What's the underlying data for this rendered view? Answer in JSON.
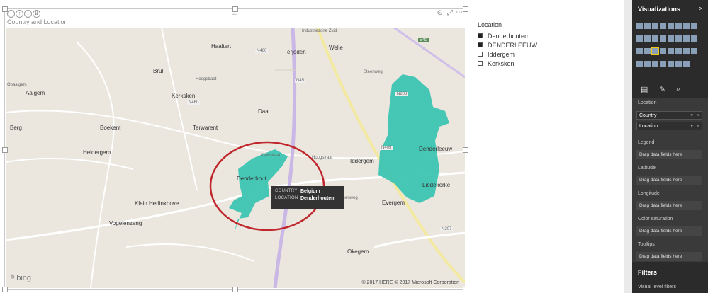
{
  "visual": {
    "title": "Country and Location",
    "tooltip": {
      "country_key": "COUNTRY",
      "country_val": "Belgium",
      "location_key": "LOCATION",
      "location_val": "Denderhoutem"
    },
    "bing": "bing",
    "copyright": "© 2017 HERE  © 2017 Microsoft Corporation"
  },
  "map_labels": [
    {
      "name": "Brul",
      "text": "Brul"
    },
    {
      "name": "Haaltert",
      "text": "Haaltert"
    },
    {
      "name": "Terjoden",
      "text": "Terjoden"
    },
    {
      "name": "Welle",
      "text": "Welle"
    },
    {
      "name": "Aaigem",
      "text": "Aaigem"
    },
    {
      "name": "Kerksken",
      "text": "Kerksken"
    },
    {
      "name": "Daal",
      "text": "Daal"
    },
    {
      "name": "Berg",
      "text": "Berg"
    },
    {
      "name": "Boekent",
      "text": "Boekent"
    },
    {
      "name": "Terwarent",
      "text": "Terwarent"
    },
    {
      "name": "Heldergem",
      "text": "Heldergem"
    },
    {
      "name": "Denderhoutem",
      "text": "Denderhout"
    },
    {
      "name": "Iddergem",
      "text": "Iddergem"
    },
    {
      "name": "Denderleeuw",
      "text": "Denderleeuw"
    },
    {
      "name": "Liedekerke",
      "text": "Liedekerke"
    },
    {
      "name": "Klein Herlinkhove",
      "text": "Klein Herlinkhove"
    },
    {
      "name": "Evergem",
      "text": "Evergem"
    },
    {
      "name": "Vogelenzang",
      "text": "Vogelenzang"
    },
    {
      "name": "Okegem",
      "text": "Okegem"
    }
  ],
  "map_road_labels": [
    {
      "name": "industriezone",
      "text": "Industriezone Zuid"
    },
    {
      "name": "n460-1",
      "text": "N460"
    },
    {
      "name": "n460-2",
      "text": "N460"
    },
    {
      "name": "n45",
      "text": "N45"
    },
    {
      "name": "n208",
      "text": "N208"
    },
    {
      "name": "n405",
      "text": "N405"
    },
    {
      "name": "n207",
      "text": "N207"
    },
    {
      "name": "e40",
      "text": "E40"
    },
    {
      "name": "steenweg-1",
      "text": "Steenweg"
    },
    {
      "name": "steenweg-2",
      "text": "Steenweg"
    },
    {
      "name": "hoogstraat-1",
      "text": "Hoogstraat"
    },
    {
      "name": "hoogstraat-2",
      "text": "Hoogstraat"
    },
    {
      "name": "kerkstraat",
      "text": "Kerkstraat"
    },
    {
      "name": "opaalgem",
      "text": "Opaalgem"
    }
  ],
  "legend": {
    "title": "Location",
    "items": [
      {
        "label": "Denderhoutem",
        "selected": true
      },
      {
        "label": "DENDERLEEUW",
        "selected": true
      },
      {
        "label": "Iddergem",
        "selected": false
      },
      {
        "label": "Kerksken",
        "selected": false
      }
    ]
  },
  "pane": {
    "title": "Visualizations",
    "arrow": ">",
    "wells": {
      "location_label": "Location",
      "fields": [
        "Country",
        "Location"
      ],
      "legend_label": "Legend",
      "latitude_label": "Latitude",
      "longitude_label": "Longitude",
      "color_label": "Color saturation",
      "tooltips_label": "Tooltips",
      "drop_text": "Drag data fields here"
    },
    "filters_title": "Filters",
    "filters_sub": "Visual level filters"
  },
  "colors": {
    "region": "#3dc4b1",
    "ellipse": "#c0272d",
    "road": "#c9b7e6"
  }
}
